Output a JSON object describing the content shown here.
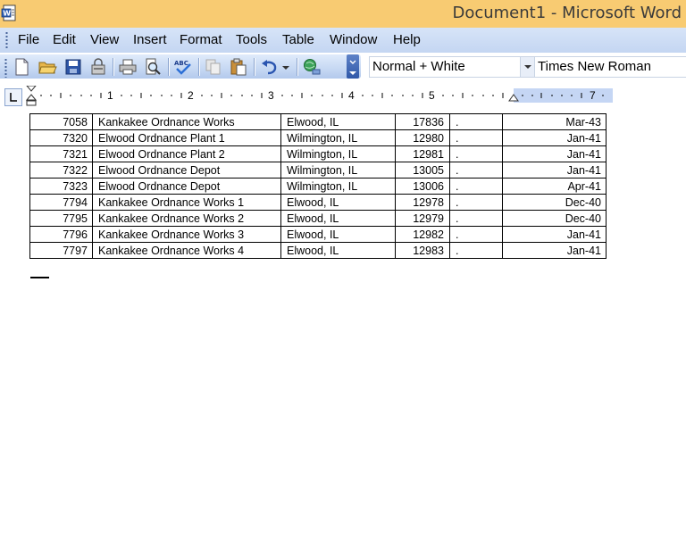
{
  "window": {
    "title": "Document1 - Microsoft Word",
    "icon": "word-document-icon",
    "titlebar_color": "#f8cb72"
  },
  "menu": {
    "items": [
      {
        "label": "File",
        "id": "file"
      },
      {
        "label": "Edit",
        "id": "edit"
      },
      {
        "label": "View",
        "id": "view"
      },
      {
        "label": "Insert",
        "id": "insert"
      },
      {
        "label": "Format",
        "id": "format"
      },
      {
        "label": "Tools",
        "id": "tools"
      },
      {
        "label": "Table",
        "id": "table"
      },
      {
        "label": "Window",
        "id": "window"
      },
      {
        "label": "Help",
        "id": "help"
      }
    ]
  },
  "toolbar": {
    "buttons": [
      "new-document-icon",
      "open-folder-icon",
      "save-icon",
      "permission-icon",
      "print-icon",
      "print-preview-icon",
      "spelling-icon",
      "copy-icon",
      "paste-icon",
      "undo-icon",
      "undo-dropdown-icon",
      "research-icon"
    ],
    "style_value": "Normal + White",
    "font_value": "Times New Roman"
  },
  "ruler": {
    "numbers": [
      "1",
      "2",
      "3",
      "4",
      "5",
      "7"
    ],
    "margin_color": "#c5d6f4"
  },
  "table": {
    "rows": [
      [
        "7058",
        "Kankakee Ordnance Works",
        "Elwood, IL",
        "17836",
        ".",
        "Mar-43"
      ],
      [
        "7320",
        "Elwood Ordnance Plant 1",
        "Wilmington, IL",
        "12980",
        ".",
        "Jan-41"
      ],
      [
        "7321",
        "Elwood Ordnance Plant 2",
        "Wilmington, IL",
        "12981",
        ".",
        "Jan-41"
      ],
      [
        "7322",
        "Elwood Ordnance Depot",
        "Wilmington, IL",
        "13005",
        ".",
        "Jan-41"
      ],
      [
        "7323",
        "Elwood Ordnance Depot",
        "Wilmington, IL",
        "13006",
        ".",
        "Apr-41"
      ],
      [
        "7794",
        "Kankakee Ordnance Works 1",
        "Elwood, IL",
        "12978",
        ".",
        "Dec-40"
      ],
      [
        "7795",
        "Kankakee Ordnance Works 2",
        "Elwood, IL",
        "12979",
        ".",
        "Dec-40"
      ],
      [
        "7796",
        "Kankakee Ordnance Works 3",
        "Elwood, IL",
        "12982",
        ".",
        "Jan-41"
      ],
      [
        "7797",
        "Kankakee Ordnance Works 4",
        "Elwood, IL",
        "12983",
        ".",
        "Jan-41"
      ]
    ]
  }
}
